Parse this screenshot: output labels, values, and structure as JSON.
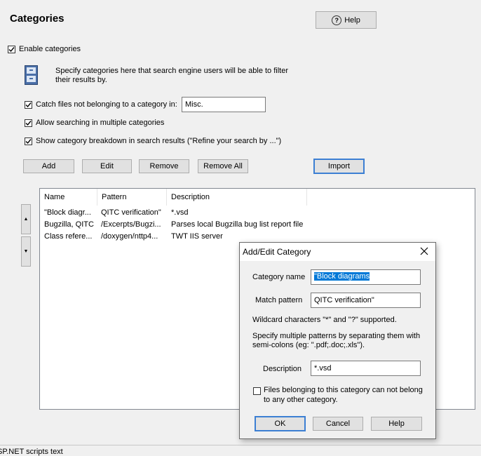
{
  "page": {
    "title": "Categories",
    "help_label": "Help"
  },
  "enable": {
    "label": "Enable categories",
    "checked": true
  },
  "info": {
    "icon": "cabinet-icon",
    "text_line1": "Specify categories here that search engine users will be able to filter",
    "text_line2": "their results by."
  },
  "options": {
    "catch_label": "Catch files not belonging to a category in:",
    "catch_value": "Misc.",
    "multi_label": "Allow searching in multiple categories",
    "breakdown_label": "Show category breakdown in search results (\"Refine your search by ...\")"
  },
  "toolbar": {
    "add": "Add",
    "edit": "Edit",
    "remove": "Remove",
    "remove_all": "Remove All",
    "import": "Import"
  },
  "list": {
    "columns": [
      "Name",
      "Pattern",
      "Description"
    ],
    "rows": [
      {
        "name": "\"Block diagr...",
        "pattern": "QITC verification\"",
        "description": "*.vsd"
      },
      {
        "name": "Bugzilla, QITC",
        "pattern": "/Excerpts/Bugzi...",
        "description": "Parses local Bugzilla bug list report file"
      },
      {
        "name": "Class refere...",
        "pattern": "/doxygen/nttp4...",
        "description": "TWT IIS server"
      }
    ]
  },
  "dialog": {
    "title": "Add/Edit Category",
    "category_name_label": "Category name",
    "category_name_value": "\"Block diagrams",
    "match_pattern_label": "Match pattern",
    "match_pattern_value": "QITC verification\"",
    "wildcard_text": "Wildcard characters \"*\" and \"?\" supported.",
    "multi_text_line1": "Specify multiple patterns by separating them with",
    "multi_text_line2": "semi-colons (eg: \".pdf;.doc;.xls\").",
    "description_label": "Description",
    "description_value": "*.vsd",
    "exclusive_line1": "Files belonging to this category can not belong",
    "exclusive_line2": "to any other category.",
    "exclusive_checked": false,
    "ok": "OK",
    "cancel": "Cancel",
    "help": "Help"
  },
  "footer": {
    "partial_text": "SP.NET scripts text"
  }
}
